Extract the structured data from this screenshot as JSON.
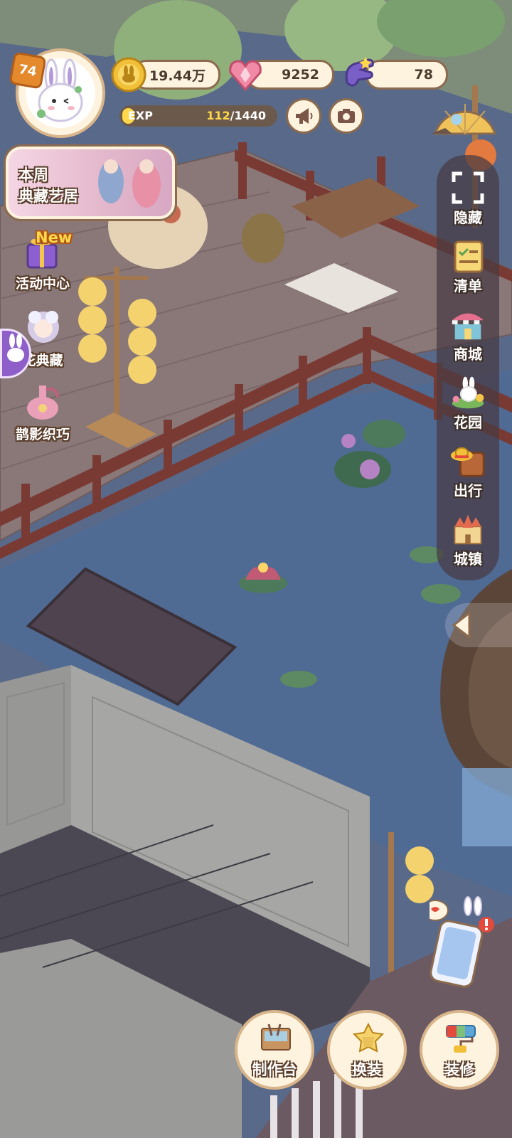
{
  "player": {
    "level": "74",
    "avatar_icon": "bunny-avatar-icon"
  },
  "resources": {
    "coins": "19.44万",
    "gems": "9252",
    "energy": "78"
  },
  "exp": {
    "label": "EXP",
    "current": "112",
    "separator": "/",
    "max": "1440",
    "fraction": 0.078
  },
  "left_menu": {
    "weekly": {
      "line1": "本周",
      "line2": "典藏艺居"
    },
    "event_badge": "New",
    "items": [
      {
        "label": "活动中心",
        "icon": "gift-box-icon"
      },
      {
        "label": "花典藏",
        "icon": "flower-fairy-icon"
      },
      {
        "label": "鹊影织巧",
        "icon": "vase-icon"
      }
    ]
  },
  "right_menu": [
    {
      "label": "隐藏",
      "icon": "hide-frame-icon"
    },
    {
      "label": "清单",
      "icon": "checklist-icon"
    },
    {
      "label": "商城",
      "icon": "shop-icon"
    },
    {
      "label": "花园",
      "icon": "garden-icon"
    },
    {
      "label": "出行",
      "icon": "suitcase-icon"
    },
    {
      "label": "城镇",
      "icon": "castle-icon"
    }
  ],
  "bottom_menu": [
    {
      "label": "制作台",
      "icon": "workbench-icon"
    },
    {
      "label": "换装",
      "icon": "outfit-icon"
    },
    {
      "label": "装修",
      "icon": "paint-roller-icon"
    }
  ],
  "colors": {
    "panel_bg": "#fdf3df",
    "panel_border": "#8b6a4e",
    "exp_highlight": "#ffd84a",
    "pond": "#4f6a93",
    "deck": "#7c6a68"
  }
}
